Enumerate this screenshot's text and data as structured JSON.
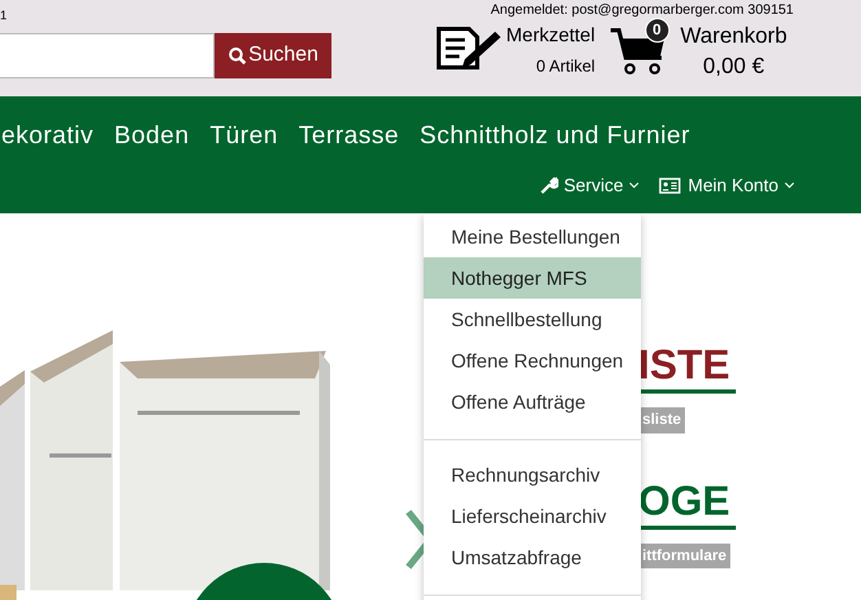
{
  "top_bar": {
    "corner_text": "1",
    "login_info": "Angemeldet: post@gregormarberger.com 309151",
    "search": {
      "button": "Suchen"
    },
    "wishlist": {
      "label": "Merkzettel",
      "count": "0 Artikel"
    },
    "cart": {
      "badge": "0",
      "label": "Warenkorb",
      "total": "0,00 €"
    }
  },
  "nav": {
    "categories": [
      "ekorativ",
      "Boden",
      "Türen",
      "Terrasse",
      "Schnittholz und Furnier"
    ],
    "menus": [
      {
        "kind": "service",
        "label": "Service"
      },
      {
        "kind": "account",
        "label": "Mein Konto"
      }
    ]
  },
  "dropdown": {
    "groups": [
      [
        {
          "label": "Meine Bestellungen",
          "selected": false
        },
        {
          "label": "Nothegger MFS",
          "selected": true
        },
        {
          "label": "Schnellbestellung",
          "selected": false
        },
        {
          "label": "Offene Rechnungen",
          "selected": false
        },
        {
          "label": "Offene Aufträge",
          "selected": false
        }
      ],
      [
        {
          "label": "Rechnungsarchiv",
          "selected": false
        },
        {
          "label": "Lieferscheinarchiv",
          "selected": false
        },
        {
          "label": "Umsatzabfrage",
          "selected": false
        }
      ]
    ]
  },
  "content": {
    "blocks": [
      {
        "heading": "ISTE",
        "color": "#8b1f23",
        "badge": "sliste"
      },
      {
        "heading": "OGE",
        "color": "#03652d",
        "badge": "ittformulare"
      }
    ]
  }
}
